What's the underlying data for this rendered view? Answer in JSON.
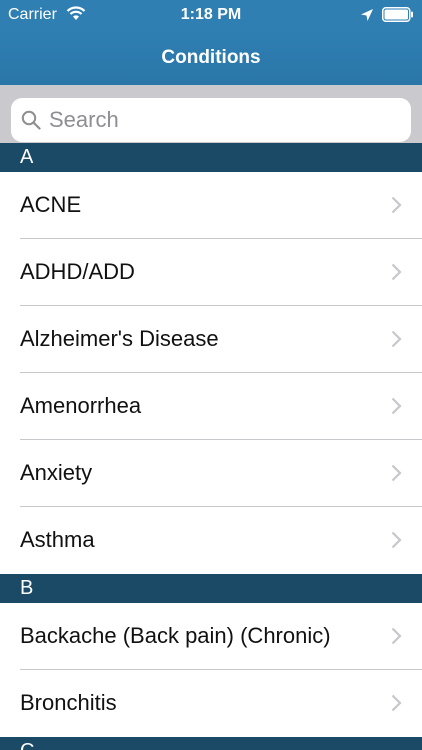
{
  "status": {
    "carrier": "Carrier",
    "time": "1:18 PM",
    "wifi_icon": "wifi-icon",
    "location_icon": "location-arrow-icon",
    "battery_icon": "battery-full-icon"
  },
  "nav": {
    "title": "Conditions"
  },
  "search": {
    "placeholder": "Search",
    "icon": "search-icon"
  },
  "colors": {
    "nav_blue": "#2f7fb3",
    "section_header": "#1a4a66",
    "search_bg": "#c9c9ce"
  },
  "sections": [
    {
      "letter": "A",
      "items": [
        {
          "label": "ACNE"
        },
        {
          "label": "ADHD/ADD"
        },
        {
          "label": "Alzheimer's Disease"
        },
        {
          "label": "Amenorrhea"
        },
        {
          "label": "Anxiety"
        },
        {
          "label": "Asthma"
        }
      ]
    },
    {
      "letter": "B",
      "items": [
        {
          "label": "Backache (Back pain) (Chronic)"
        },
        {
          "label": "Bronchitis"
        }
      ]
    },
    {
      "letter": "C",
      "items": []
    }
  ]
}
